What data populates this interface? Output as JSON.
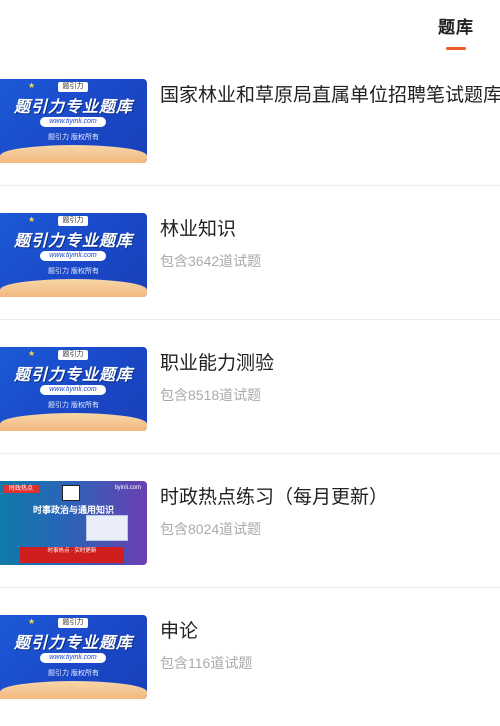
{
  "tab": {
    "label": "题库",
    "accent": "#e85a2a"
  },
  "thumb_text": {
    "headline": "题引力专业题库",
    "url": "www.tiyinli.com",
    "sub": "题引力 版权所有",
    "badge": "题引力",
    "news_tag": "时政热点",
    "news_site": "tiyinli.com",
    "news_title": "时事政治与通用知识",
    "news_banner": "时事热点 · 实时更新"
  },
  "items": [
    {
      "title": "国家林业和草原局直属单位招聘笔试题库",
      "count": ""
    },
    {
      "title": "林业知识",
      "count": "包含3642道试题"
    },
    {
      "title": "职业能力测验",
      "count": "包含8518道试题"
    },
    {
      "title": "时政热点练习（每月更新）",
      "count": "包含8024道试题"
    },
    {
      "title": "申论",
      "count": "包含116道试题"
    }
  ]
}
